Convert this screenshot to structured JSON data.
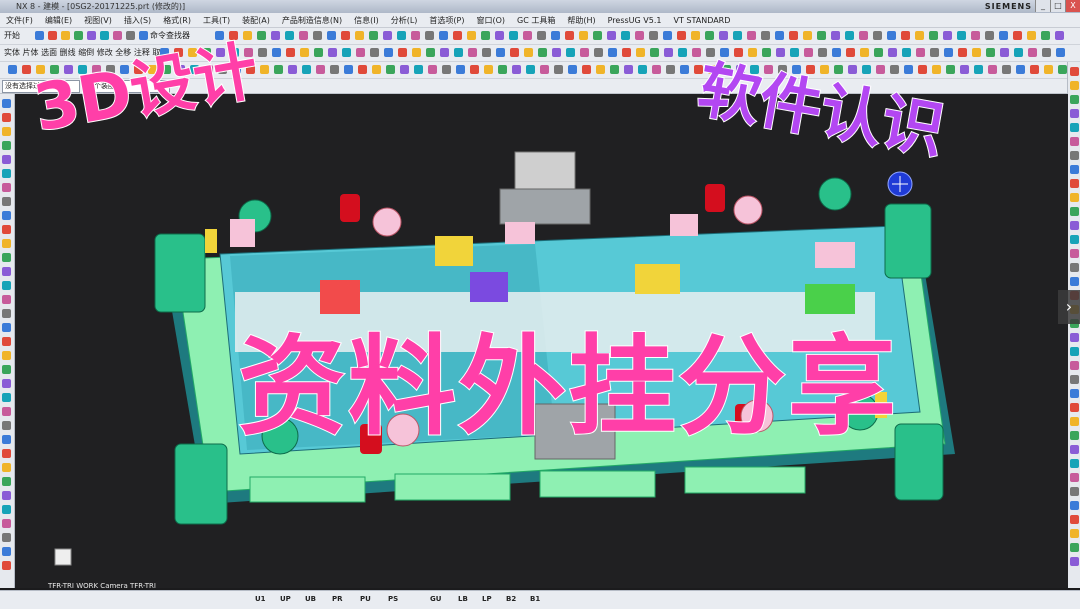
{
  "window": {
    "title": "NX 8 - 建模 - [0SG2-20171225.prt (修改的)]",
    "brand": "SIEMENS",
    "buttons": [
      "_",
      "□",
      "X"
    ]
  },
  "menu": {
    "items": [
      "文件(F)",
      "编辑(E)",
      "视图(V)",
      "插入(S)",
      "格式(R)",
      "工具(T)",
      "装配(A)",
      "产品制造信息(N)",
      "信息(I)",
      "分析(L)",
      "首选项(P)",
      "窗口(O)",
      "GC 工具箱",
      "帮助(H)",
      "PressUG V5.1",
      "VT STANDARD"
    ]
  },
  "toolbar": {
    "row1_label": "开始",
    "row1_text": "命令查找器",
    "row2_items": [
      "实体",
      "片体",
      "选面",
      "删线",
      "缩倒",
      "修改",
      "全移",
      "注释",
      "取消"
    ],
    "filter_label": "没有选择过滤器",
    "assembly_label": "整个装配"
  },
  "overlay": {
    "top_left": "3D设计",
    "top_right": "软件认识",
    "center": "资料外挂分享"
  },
  "viewport": {
    "camera_label": "TFR-TRI WORK Camera TFR-TRI"
  },
  "statusbar": {
    "items": [
      "U1",
      "UP",
      "UB",
      "PR",
      "PU",
      "PS",
      "GU",
      "LB",
      "LP",
      "B2",
      "B1"
    ]
  },
  "colors": {
    "plate_base": "#57c9d6",
    "plate_bottom": "#8ef0b2",
    "overlay_pink": "#ff3fa8",
    "overlay_purple": "#b347f2"
  },
  "nav": {
    "arrow": "›"
  }
}
